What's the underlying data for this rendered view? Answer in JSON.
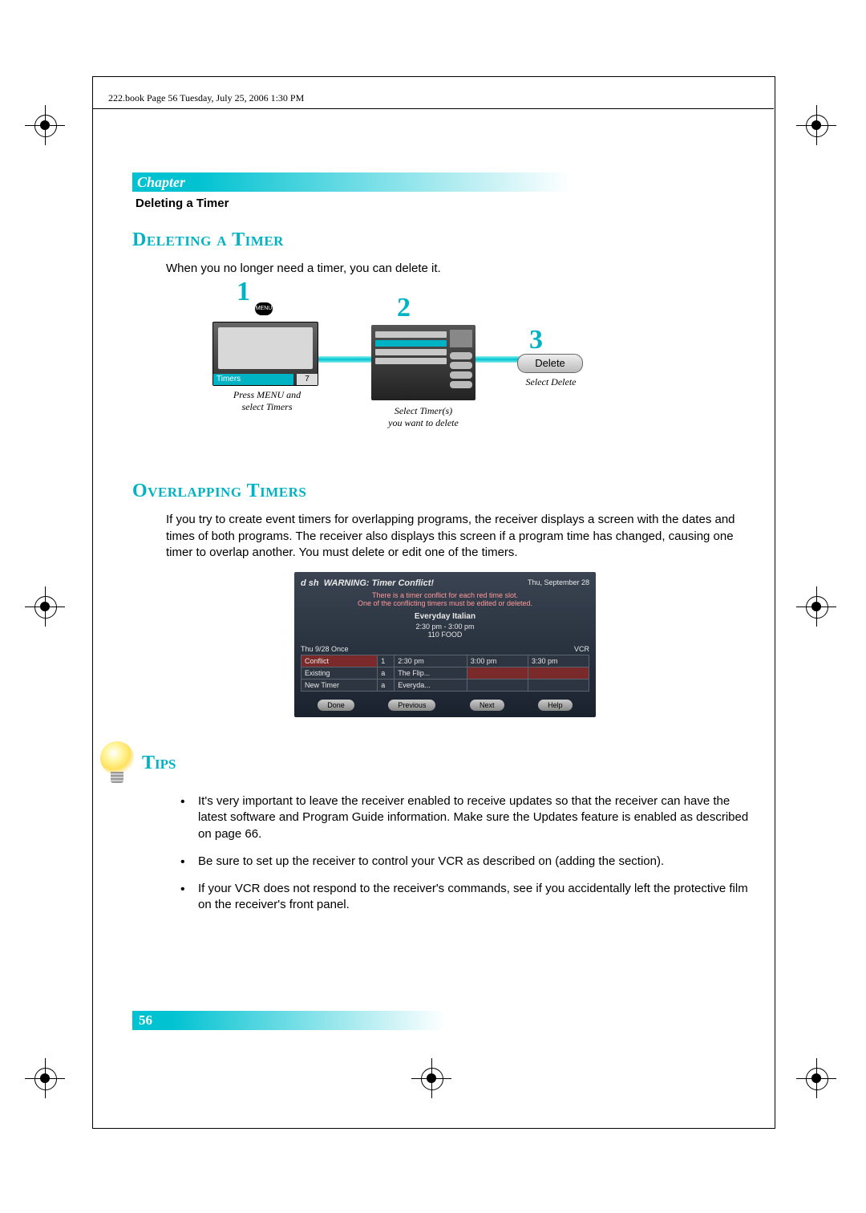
{
  "bookline": "222.book  Page 56  Tuesday, July 25, 2006  1:30 PM",
  "chapter_label": "Chapter",
  "section_header": "Deleting a Timer",
  "h_deleting": "Deleting a Timer",
  "deleting_intro": "When you no longer need a timer, you can delete it.",
  "step1_num": "1",
  "step1_menu": "MENU",
  "step1_screen_label": "Timers",
  "step1_screen_num": "7",
  "step1_caption_a": "Press MENU and",
  "step1_caption_b": "select Timers",
  "step2_num": "2",
  "step2_caption_a": "Select Timer(s)",
  "step2_caption_b": "you want to delete",
  "step3_num": "3",
  "step3_btn": "Delete",
  "step3_caption": "Select Delete",
  "h_overlap": "Overlapping Timers",
  "overlap_body": "If you try to create event timers for overlapping programs, the receiver displays a screen with the dates and times of both programs. The receiver also displays this screen if a program time has changed, causing one timer to overlap another. You must delete or edit one of the timers.",
  "conflict": {
    "brand": "d sh",
    "title": "WARNING: Timer Conflict!",
    "date": "Thu, September 28",
    "msg1": "There is a timer conflict for each red time slot.",
    "msg2": "One of the conflicting timers must be edited or deleted.",
    "prog": "Everyday Italian",
    "time": "2:30 pm - 3:00 pm",
    "chan": "110 FOOD",
    "row_left": "Thu 9/28 Once",
    "row_right": "VCR",
    "col1": "2:30 pm",
    "col2": "3:00 pm",
    "col3": "3:30 pm",
    "r_conflict": "Conflict",
    "r_existing": "Existing",
    "r_existing_val": "The Flip...",
    "r_new": "New Timer",
    "r_new_val": "Everyda...",
    "btn_done": "Done",
    "btn_prev": "Previous",
    "btn_next": "Next",
    "btn_help": "Help"
  },
  "h_tips": "Tips",
  "tips": [
    "It's very important to leave the receiver enabled to receive updates so that the receiver can have the latest software and Program Guide information. Make sure the Updates feature is enabled as described on page 66.",
    "Be sure to set up the receiver to control your VCR as described on (adding the section).",
    "If your VCR does not respond to the receiver's commands, see if you accidentally left the protective film on the receiver's front panel."
  ],
  "page_number": "56"
}
